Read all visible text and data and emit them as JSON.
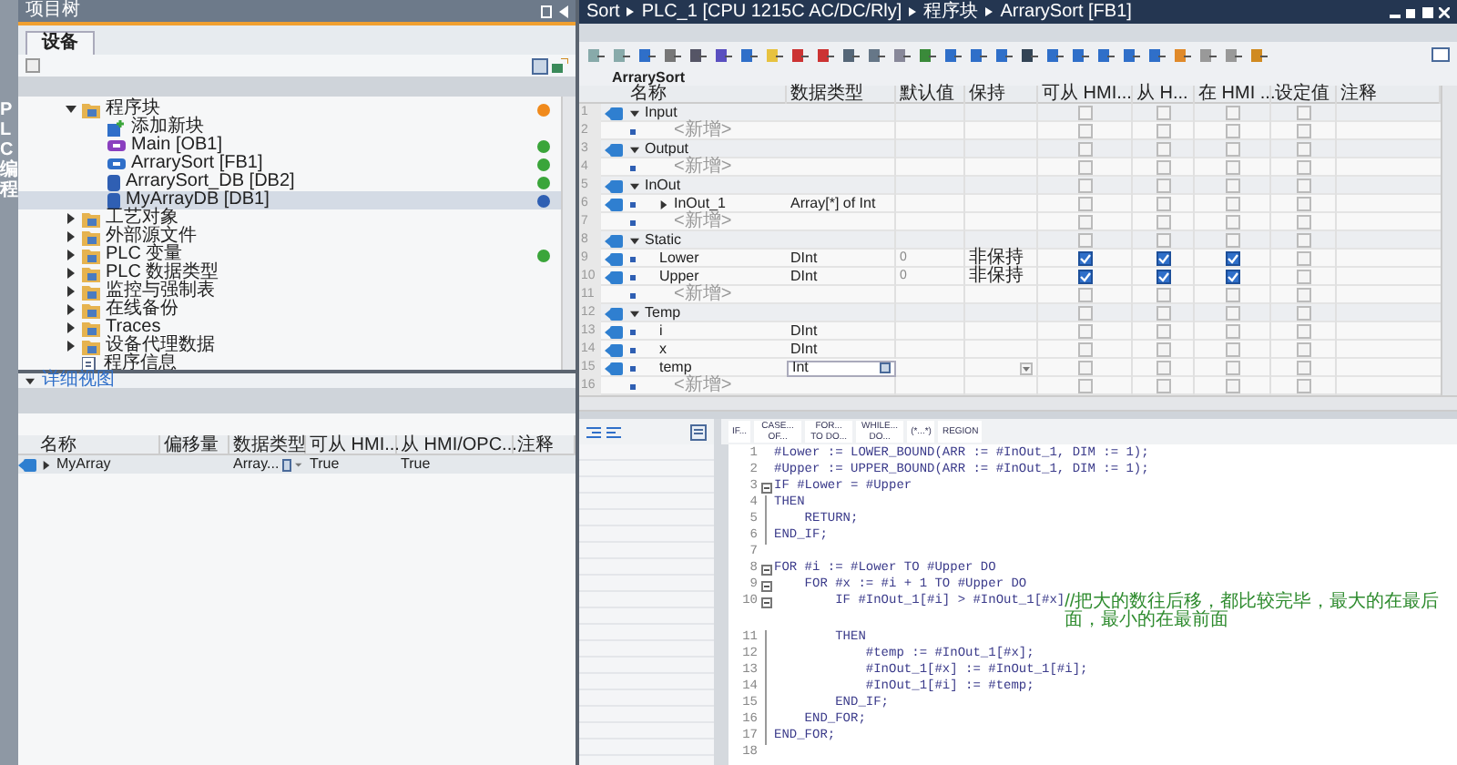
{
  "side_strip": {
    "label": "PLC 编程"
  },
  "project_tree": {
    "title": "项目树",
    "tabs": [
      {
        "label": "设备",
        "selected": true
      }
    ],
    "items": [
      {
        "label": "程序块",
        "kind": "folder",
        "expanded": true,
        "selected": false,
        "color": "#f08a1c",
        "children": [
          {
            "label": "添加新块",
            "kind": "add",
            "selected": false
          },
          {
            "label": "Main [OB1]",
            "kind": "ob",
            "selected": false,
            "color": "#3aa53a"
          },
          {
            "label": "ArrarySort [FB1]",
            "kind": "fb",
            "selected": false,
            "color": "#3aa53a"
          },
          {
            "label": "ArrarySort_DB [DB2]",
            "kind": "db",
            "selected": false,
            "color": "#3aa53a"
          },
          {
            "label": "MyArrayDB [DB1]",
            "kind": "db",
            "selected": true,
            "color": "#2f5fb3"
          }
        ]
      },
      {
        "label": "工艺对象",
        "kind": "folder",
        "expanded": false,
        "selected": false
      },
      {
        "label": "外部源文件",
        "kind": "folder",
        "expanded": false,
        "selected": false
      },
      {
        "label": "PLC 变量",
        "kind": "folder",
        "expanded": false,
        "selected": false,
        "color": "#3aa53a"
      },
      {
        "label": "PLC 数据类型",
        "kind": "folder",
        "expanded": false,
        "selected": false
      },
      {
        "label": "监控与强制表",
        "kind": "folder",
        "expanded": false,
        "selected": false
      },
      {
        "label": "在线备份",
        "kind": "folder",
        "expanded": false,
        "selected": false
      },
      {
        "label": "Traces",
        "kind": "folder",
        "expanded": false,
        "selected": false
      },
      {
        "label": "设备代理数据",
        "kind": "folder",
        "expanded": false,
        "selected": false
      },
      {
        "label": "程序信息",
        "kind": "info",
        "selected": false
      }
    ]
  },
  "detail_view": {
    "title": "详细视图",
    "expanded": true,
    "columns": [
      "名称",
      "偏移量",
      "数据类型",
      "可从 HMI...",
      "从 HMI/OPC...",
      "注释"
    ],
    "rows": [
      {
        "name": "MyArray",
        "expanded": false,
        "type": "Array...",
        "hmi_accessible": "True",
        "hmi_visible": "True"
      }
    ]
  },
  "editor": {
    "breadcrumb": [
      "Sort",
      "PLC_1 [CPU 1215C AC/DC/Rly]",
      "程序块",
      "ArrarySort [FB1]"
    ],
    "block_name": "ArrarySort",
    "columns": [
      "名称",
      "数据类型",
      "默认值",
      "保持",
      "可从 HMI...",
      "从 H...",
      "在 HMI ...",
      "设定值",
      "注释"
    ],
    "rows": [
      {
        "num": "1",
        "kind": "section",
        "name": "Input",
        "expanded": true,
        "hmi_accessible": false,
        "hmi_visible": false,
        "hmi_writable": false,
        "setpoint": false
      },
      {
        "num": "2",
        "kind": "new",
        "name": "<新增>",
        "hmi_accessible": false,
        "hmi_visible": false,
        "hmi_writable": false,
        "setpoint": false
      },
      {
        "num": "3",
        "kind": "section",
        "name": "Output",
        "expanded": true,
        "hmi_accessible": false,
        "hmi_visible": false,
        "hmi_writable": false,
        "setpoint": false
      },
      {
        "num": "4",
        "kind": "new",
        "name": "<新增>",
        "hmi_accessible": false,
        "hmi_visible": false,
        "hmi_writable": false,
        "setpoint": false
      },
      {
        "num": "5",
        "kind": "section",
        "name": "InOut",
        "expanded": true,
        "hmi_accessible": false,
        "hmi_visible": false,
        "hmi_writable": false,
        "setpoint": false
      },
      {
        "num": "6",
        "kind": "var",
        "name": "InOut_1",
        "expanded": false,
        "type": "Array[*] of Int",
        "hmi_accessible": false,
        "hmi_visible": false,
        "hmi_writable": false,
        "setpoint": false
      },
      {
        "num": "7",
        "kind": "new",
        "name": "<新增>",
        "hmi_accessible": false,
        "hmi_visible": false,
        "hmi_writable": false,
        "setpoint": false
      },
      {
        "num": "8",
        "kind": "section",
        "name": "Static",
        "expanded": true,
        "hmi_accessible": false,
        "hmi_visible": false,
        "hmi_writable": false,
        "setpoint": false
      },
      {
        "num": "9",
        "kind": "var",
        "name": "Lower",
        "type": "DInt",
        "default": "0",
        "retain": "非保持",
        "hmi_accessible": true,
        "hmi_visible": true,
        "hmi_writable": true,
        "setpoint": false
      },
      {
        "num": "10",
        "kind": "var",
        "name": "Upper",
        "type": "DInt",
        "default": "0",
        "retain": "非保持",
        "hmi_accessible": true,
        "hmi_visible": true,
        "hmi_writable": true,
        "setpoint": false
      },
      {
        "num": "11",
        "kind": "new",
        "name": "<新增>",
        "hmi_accessible": false,
        "hmi_visible": false,
        "hmi_writable": false,
        "setpoint": false
      },
      {
        "num": "12",
        "kind": "section",
        "name": "Temp",
        "expanded": true,
        "hmi_accessible": false,
        "hmi_visible": false,
        "hmi_writable": false,
        "setpoint": false
      },
      {
        "num": "13",
        "kind": "var",
        "name": "i",
        "type": "DInt",
        "hmi_accessible": false,
        "hmi_visible": false,
        "hmi_writable": false,
        "setpoint": false
      },
      {
        "num": "14",
        "kind": "var",
        "name": "x",
        "type": "DInt",
        "hmi_accessible": false,
        "hmi_visible": false,
        "hmi_writable": false,
        "setpoint": false
      },
      {
        "num": "15",
        "kind": "editing",
        "name": "temp",
        "type": "Int",
        "hmi_accessible": false,
        "hmi_visible": false,
        "hmi_writable": false,
        "setpoint": false
      },
      {
        "num": "16",
        "kind": "new",
        "name": "<新增>",
        "hmi_accessible": false,
        "hmi_visible": false,
        "hmi_writable": false,
        "setpoint": false
      }
    ],
    "code_templates": [
      "IF...",
      "CASE... OF...",
      "FOR... TO DO...",
      "WHILE... DO...",
      "(*...*)",
      "REGION"
    ],
    "code": [
      {
        "num": "1",
        "text": "#Lower := LOWER_BOUND(ARR := #InOut_1, DIM := 1);"
      },
      {
        "num": "2",
        "text": "#Upper := UPPER_BOUND(ARR := #InOut_1, DIM := 1);"
      },
      {
        "num": "3",
        "fold": true,
        "text": "IF #Lower = #Upper"
      },
      {
        "num": "4",
        "fold": false,
        "text": "THEN"
      },
      {
        "num": "5",
        "fold": false,
        "text": "    RETURN;"
      },
      {
        "num": "6",
        "fold": false,
        "text": "END_IF;"
      },
      {
        "num": "7"
      },
      {
        "num": "8",
        "fold": true,
        "text": "FOR #i := #Lower TO #Upper DO"
      },
      {
        "num": "9",
        "fold": true,
        "text": "    FOR #x := #i + 1 TO #Upper DO"
      },
      {
        "num": "10",
        "fold": true,
        "text": "        IF #InOut_1[#i] > #InOut_1[#x]",
        "comment": "//把大的数往后移，都比较完毕，最大的在最后面，最小的在最前面"
      },
      {
        "num": "11",
        "fold": false,
        "text": "        THEN"
      },
      {
        "num": "12",
        "fold": false,
        "text": "            #temp := #InOut_1[#x];"
      },
      {
        "num": "13",
        "fold": false,
        "text": "            #InOut_1[#x] := #InOut_1[#i];"
      },
      {
        "num": "14",
        "fold": false,
        "text": "            #InOut_1[#i] := #temp;"
      },
      {
        "num": "15",
        "fold": false,
        "text": "        END_IF;"
      },
      {
        "num": "16",
        "fold": false,
        "text": "    END_FOR;"
      },
      {
        "num": "17",
        "fold": false,
        "text": "END_FOR;"
      },
      {
        "num": "18"
      }
    ]
  }
}
